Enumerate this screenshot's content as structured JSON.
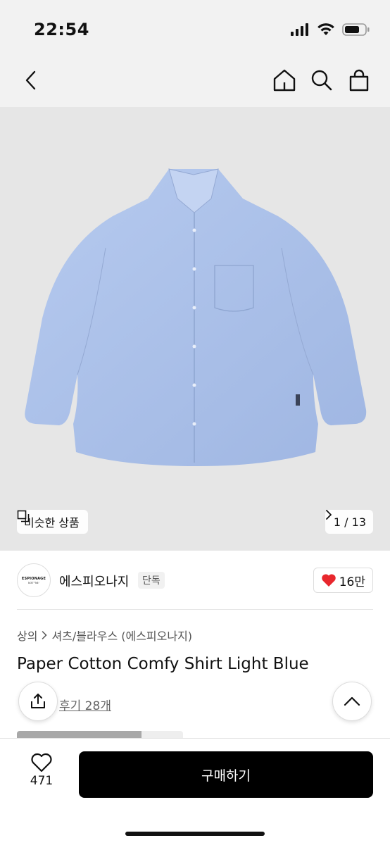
{
  "status_bar": {
    "time": "22:54",
    "icons": [
      "signal-icon",
      "wifi-icon",
      "battery-icon"
    ]
  },
  "nav": {
    "icons": [
      "back-icon",
      "home-icon",
      "search-icon",
      "cart-icon"
    ]
  },
  "hero": {
    "similar_label": "비슷한 상품",
    "page_indicator": "1 / 13",
    "shirt_color": "#a9c0e8"
  },
  "brand": {
    "logo_text": "ESPIONAGE",
    "logo_subtext": "N37°56'",
    "name": "에스피오나지",
    "tag": "단독",
    "likes": "16만"
  },
  "product": {
    "breadcrumb": [
      "상의",
      "셔츠/블라우스 (에스피오나지)"
    ],
    "title": "Paper Cotton Comfy Shirt Light Blue",
    "review_link": "후기 28개"
  },
  "gallery_progress": 0.75,
  "bottom": {
    "wish_count": "471",
    "buy_label": "구매하기"
  },
  "colors": {
    "accent": "#000000",
    "heart": "#e8272d",
    "background": "#f2f2f2"
  }
}
